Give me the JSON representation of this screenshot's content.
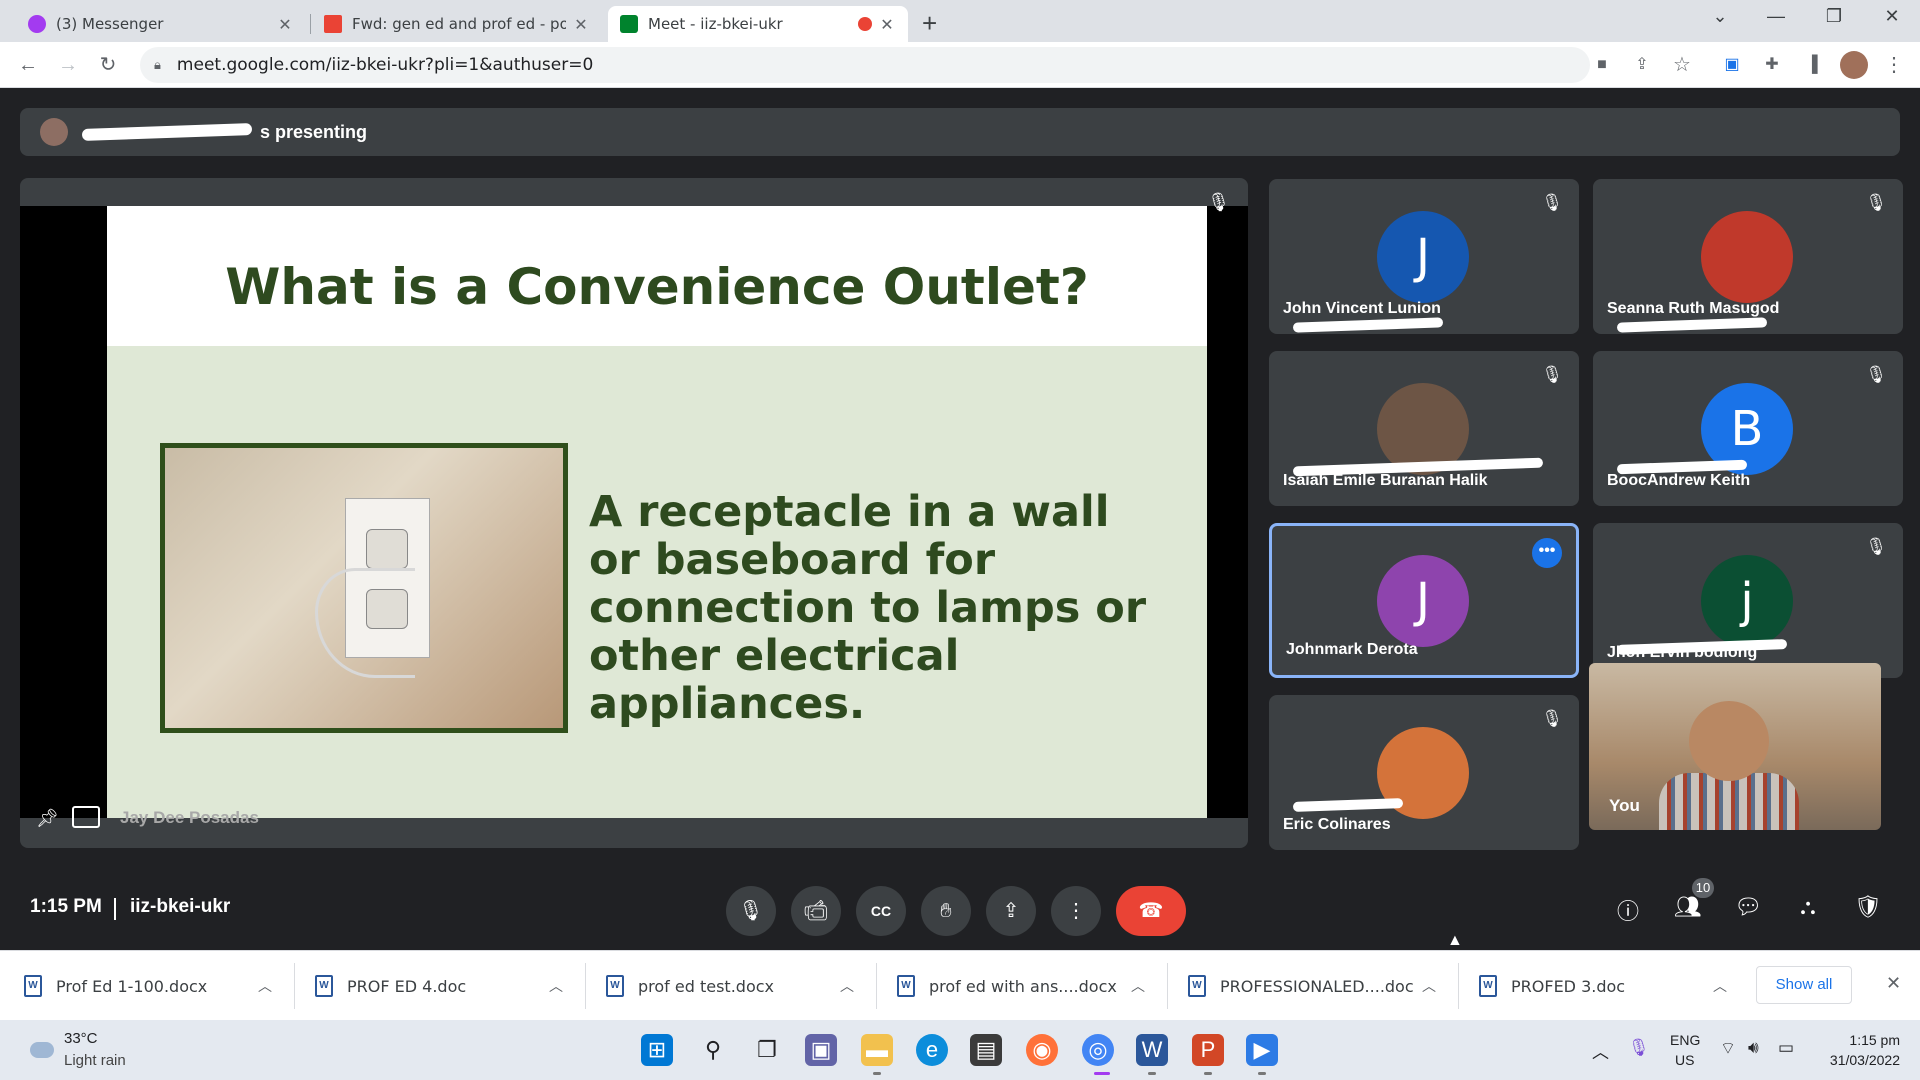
{
  "browser": {
    "tabs": [
      {
        "title": "(3) Messenger",
        "color": "#a33bf0"
      },
      {
        "title": "Fwd: gen ed and prof ed - posad",
        "color": "#ea4335"
      },
      {
        "title": "Meet - iiz-bkei-ukr",
        "color": "#00832d"
      }
    ],
    "new_tab": "+",
    "url": "meet.google.com/iiz-bkei-ukr?pli=1&authuser=0"
  },
  "meet": {
    "presenting_text": "s presenting",
    "slide": {
      "title": "What is a Convenience Outlet?",
      "body": "A receptacle in a wall or baseboard for connection to lamps or other electrical appliances."
    },
    "presenter_name": "Jay Dee Posadas",
    "participants": [
      {
        "name": "John Vincent Lunion",
        "initial": "J",
        "color": "#1557b0"
      },
      {
        "name": "Seanna Ruth Masugod",
        "initial": "",
        "color": "#c0392b"
      },
      {
        "name": "Isaiah Emile Buranan Halik",
        "initial": "",
        "color": "#6d5545"
      },
      {
        "name": "BoocAndrew Keith",
        "initial": "B",
        "color": "#1a73e8"
      },
      {
        "name": "Johnmark Derota",
        "initial": "J",
        "color": "#8e44ad"
      },
      {
        "name": "Jhon Ervin bodlong",
        "initial": "j",
        "color": "#0b4f33"
      },
      {
        "name": "Eric Colinares",
        "initial": "",
        "color": "#d4733a"
      }
    ],
    "self_label": "You",
    "time": "1:15 PM",
    "meeting_code": "iiz-bkei-ukr",
    "people_count": "10"
  },
  "downloads": {
    "files": [
      "Prof Ed 1-100.docx",
      "PROF ED 4.doc",
      "prof ed test.docx",
      "prof ed with ans....docx",
      "PROFESSIONALED....doc",
      "PROFED 3.doc"
    ],
    "show_all": "Show all"
  },
  "taskbar": {
    "temp": "33°C",
    "weather": "Light rain",
    "lang_top": "ENG",
    "lang_bottom": "US",
    "time": "1:15 pm",
    "date": "31/03/2022"
  }
}
